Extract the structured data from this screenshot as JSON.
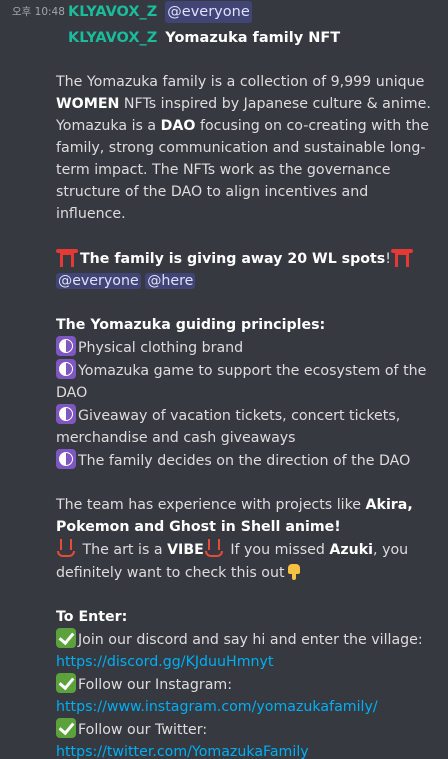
{
  "header": {
    "timestamp": "오후 10:48",
    "author": "KLYAVOX_Z",
    "mention": "@everyone"
  },
  "reply": {
    "author": "KLYAVOX_Z",
    "title": "Yomazuka family NFT"
  },
  "intro": {
    "t1": "The Yomazuka family is a collection of 9,999 unique ",
    "b1": "WOMEN",
    "t2": " NFTs inspired by Japanese culture & anime. Yomazuka is a ",
    "b2": "DAO",
    "t3": " focusing on co-creating with the family, strong communication and sustainable long-term impact. The NFTs work as the governance structure of the DAO to align incentives and influence."
  },
  "giveaway": {
    "text": "The family is giving away 20 WL spots",
    "exclaim": "!",
    "mention_everyone": "@everyone",
    "mention_here": "@here"
  },
  "principles": {
    "heading": "The Yomazuka guiding principles:",
    "items": [
      "Physical clothing brand",
      "Yomazuka game to support the ecosystem of the DAO",
      "Giveaway of vacation tickets, concert tickets, merchandise and cash giveaways",
      "The family decides on the direction of the DAO"
    ]
  },
  "team": {
    "t1": "The team has experience with projects like ",
    "b1": "Akira, Pokemon and Ghost in Shell anime!",
    "t2": " The art is a ",
    "b2": "VIBE",
    "t3": " If you missed ",
    "b3": "Azuki",
    "t4": ", you definitely want to check this out"
  },
  "enter": {
    "heading": "To Enter:",
    "steps": [
      {
        "text": "Join our discord and say hi and enter the village:",
        "link": "https://discord.gg/KJduuHmnyt"
      },
      {
        "text": "Follow our Instagram:",
        "link": "https://www.instagram.com/yomazukafamily/"
      },
      {
        "text": "Follow our Twitter:",
        "link": "https://twitter.com/YomazukaFamily"
      }
    ]
  },
  "icons": {
    "check": "check-mark-emoji",
    "yin_yang": "yin-yang-emoji",
    "torii": "torii-gate-emoji",
    "hot_springs": "hot-springs-emoji",
    "pointing_down": "pointing-down-emoji"
  },
  "colors": {
    "background": "#36393f",
    "author": "#1abc9c",
    "link": "#00aff4",
    "mention_bg": "#5865f24d"
  }
}
